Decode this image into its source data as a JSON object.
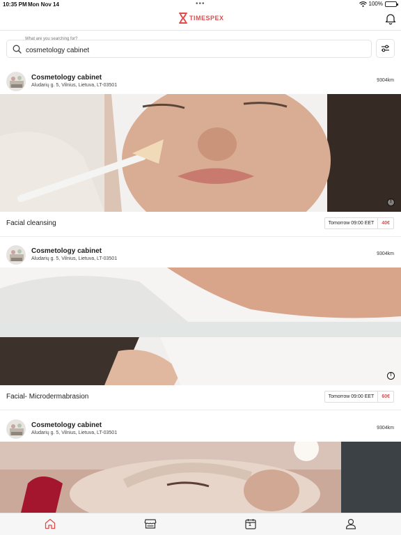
{
  "status_bar": {
    "time": "10:35 PM",
    "date": "Mon Nov 14",
    "battery": "100%",
    "dots": "•••"
  },
  "header": {
    "brand": "TIMESPEX",
    "brand_color": "#e04b4b"
  },
  "search": {
    "label": "What are you searching for?",
    "value": "cosmetology cabinet"
  },
  "results": [
    {
      "shop_name": "Cosmetology cabinet",
      "address": "Aludarių g. 5, Vilnius, Lietuva, LT-03501",
      "distance": "9304km",
      "service": "Facial cleansing",
      "slot": "Tomorrow 09:00 EET",
      "price": "40€"
    },
    {
      "shop_name": "Cosmetology cabinet",
      "address": "Aludarių g. 5, Vilnius, Lietuva, LT-03501",
      "distance": "9304km",
      "service": "Facial- Microdermabrasion",
      "slot": "Tomorrow 09:00 EET",
      "price": "60€"
    },
    {
      "shop_name": "Cosmetology cabinet",
      "address": "Aludarių g. 5, Vilnius, Lietuva, LT-03501",
      "distance": "9304km"
    }
  ],
  "tabs": [
    {
      "icon": "home-icon",
      "active": true
    },
    {
      "icon": "shop-icon",
      "active": false
    },
    {
      "icon": "calendar-icon",
      "active": false,
      "badge": "1"
    },
    {
      "icon": "profile-icon",
      "active": false
    }
  ]
}
